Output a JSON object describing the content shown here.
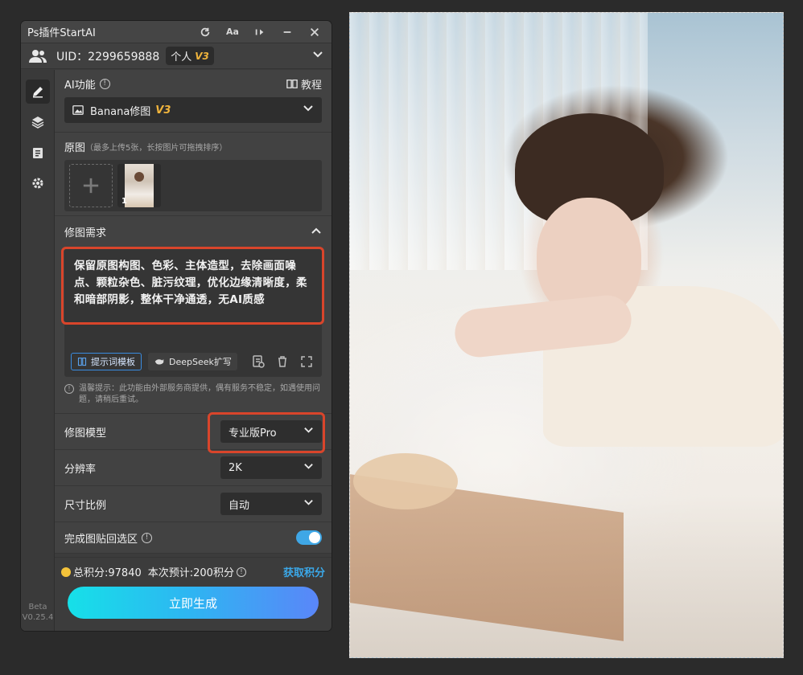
{
  "window": {
    "title": "Ps插件StartAI",
    "buttons": {
      "refresh": "refresh-icon",
      "font": "Aa",
      "pin": "pin-icon",
      "minimize": "minimize-icon",
      "close": "close-icon"
    }
  },
  "user": {
    "uid_text": "UID：2299659888",
    "account_type": "个人",
    "level": "V3"
  },
  "sidebar": {
    "items": [
      "edit-icon",
      "layers-icon",
      "clipboard-icon",
      "gear-icon"
    ],
    "beta_label": "Beta",
    "version": "V0.25.4"
  },
  "ai_function": {
    "label": "AI功能",
    "tutorial": "教程",
    "selected": "Banana修图",
    "selected_level": "V3"
  },
  "source_images": {
    "label": "原图",
    "hint": "（最多上传5张，长按图片可拖拽排序）",
    "thumb_index": "1"
  },
  "requirements": {
    "label": "修图需求",
    "text": "保留原图构图、色彩、主体造型，去除画面噪点、颗粒杂色、脏污纹理，优化边缘清晰度，柔和暗部阴影，整体干净通透，无AI质感",
    "template_button": "提示词模板",
    "deepseek_button": "DeepSeek扩写"
  },
  "tip": "温馨提示：此功能由外部服务商提供，偶有服务不稳定，如遇使用问题，请稍后重试。",
  "options": {
    "model_label": "修图模型",
    "model_value": "专业版Pro",
    "resolution_label": "分辨率",
    "resolution_value": "2K",
    "ratio_label": "尺寸比例",
    "ratio_value": "自动",
    "paste_back_label": "完成图贴回选区",
    "paste_back_enabled": true
  },
  "footer": {
    "total_points": "总积分:97840",
    "estimate": "本次预计:200积分",
    "get_points": "获取积分",
    "generate": "立即生成"
  },
  "colors": {
    "highlight_outline": "#d9452b",
    "accent_blue": "#3ba8e8",
    "level_gold": "#f0b43c"
  }
}
